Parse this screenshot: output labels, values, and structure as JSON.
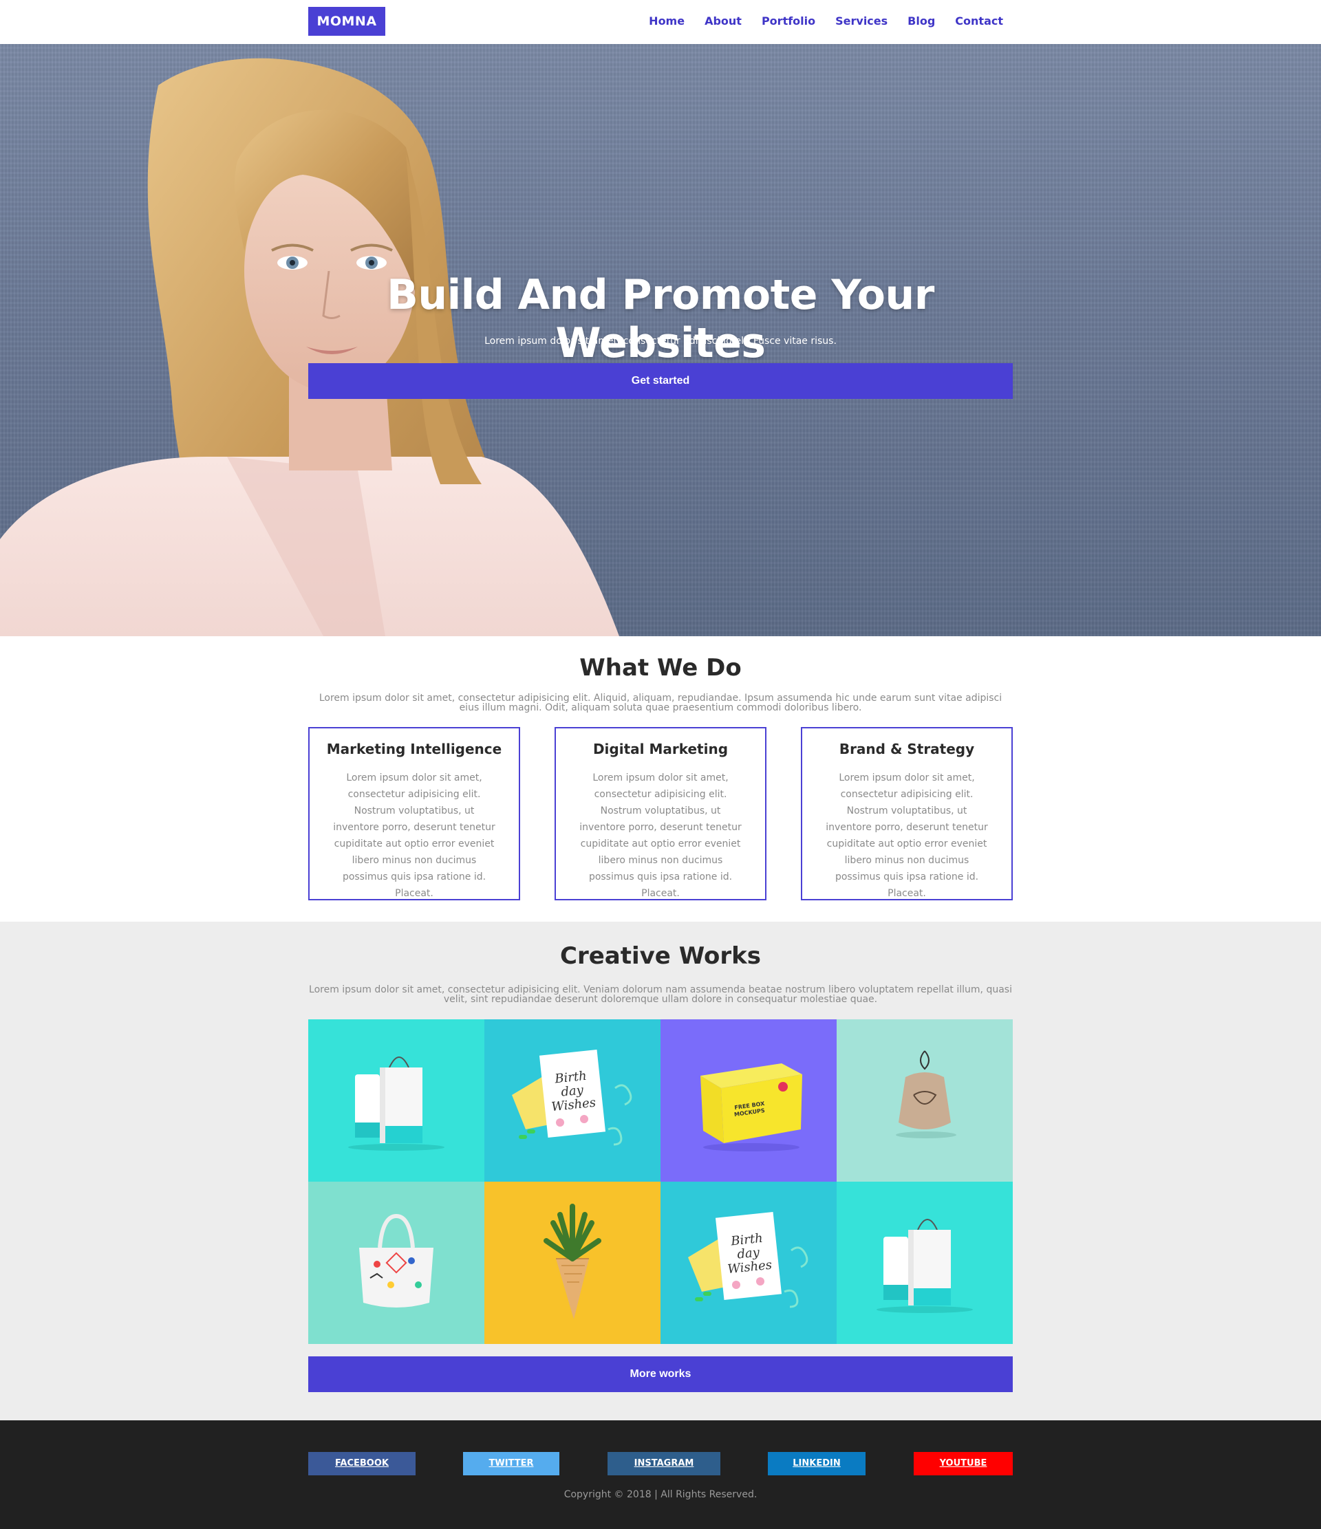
{
  "brand": {
    "name": "MOMNA",
    "color": "#4a40d4"
  },
  "nav": {
    "items": [
      "Home",
      "About",
      "Portfolio",
      "Services",
      "Blog",
      "Contact"
    ]
  },
  "hero": {
    "title": "Build And Promote Your Websites",
    "subtitle": "Lorem ipsum dolor sit amet, consectetur adipiscing elit Fusce vitae risus.",
    "cta": "Get started"
  },
  "what_we_do": {
    "title": "What We Do",
    "description": "Lorem ipsum dolor sit amet, consectetur adipisicing elit. Aliquid, aliquam, repudiandae. Ipsum assumenda hic unde earum sunt vitae adipisci eius illum magni. Odit, aliquam soluta quae praesentium commodi doloribus libero.",
    "cards": [
      {
        "title": "Marketing Intelligence",
        "text": "Lorem ipsum dolor sit amet, consectetur adipisicing elit. Nostrum voluptatibus, ut inventore porro, deserunt tenetur cupiditate aut optio error eveniet libero minus non ducimus possimus quis ipsa ratione id. Placeat."
      },
      {
        "title": "Digital Marketing",
        "text": "Lorem ipsum dolor sit amet, consectetur adipisicing elit. Nostrum voluptatibus, ut inventore porro, deserunt tenetur cupiditate aut optio error eveniet libero minus non ducimus possimus quis ipsa ratione id. Placeat."
      },
      {
        "title": "Brand & Strategy",
        "text": "Lorem ipsum dolor sit amet, consectetur adipisicing elit. Nostrum voluptatibus, ut inventore porro, deserunt tenetur cupiditate aut optio error eveniet libero minus non ducimus possimus quis ipsa ratione id. Placeat."
      }
    ]
  },
  "creative_works": {
    "title": "Creative Works",
    "description": "Lorem ipsum dolor sit amet, consectetur adipisicing elit. Veniam dolorum nam assumenda beatae nostrum libero voluptatem repellat illum, quasi velit, sint repudiandae deserunt doloremque ullam dolore in consequatur molestiae quae.",
    "more_label": "More works",
    "tiles": [
      {
        "kind": "bags",
        "bg": "#36e2d9"
      },
      {
        "kind": "birthday-card",
        "bg": "#2fc9d9",
        "card_text": "Birth day Wishes"
      },
      {
        "kind": "yellow-box",
        "bg": "#7a6cfa",
        "box_text": "FREE BOX MOCKUPS"
      },
      {
        "kind": "pouch",
        "bg": "#a3e3d8"
      },
      {
        "kind": "tote-bag",
        "bg": "#7fe0cf"
      },
      {
        "kind": "pineapple-cone",
        "bg": "#f8c22a"
      },
      {
        "kind": "birthday-card",
        "bg": "#2fc9d9",
        "card_text": "Birth day Wishes"
      },
      {
        "kind": "bags",
        "bg": "#36e2d9"
      }
    ]
  },
  "footer": {
    "social": [
      {
        "label": "FACEBOOK",
        "color": "#3b5998"
      },
      {
        "label": "TWITTER",
        "color": "#55acee"
      },
      {
        "label": "INSTAGRAM",
        "color": "#2e5e8c"
      },
      {
        "label": "LINKEDIN",
        "color": "#0a7bc2"
      },
      {
        "label": "YOUTUBE",
        "color": "#ff0000"
      }
    ],
    "copyright": "Copyright © 2018 | All Rights Reserved."
  }
}
